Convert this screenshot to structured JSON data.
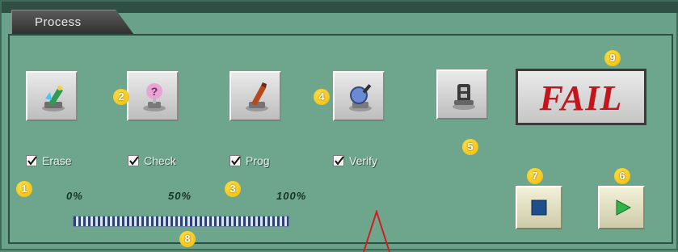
{
  "window": {
    "tab_title": "Process"
  },
  "buttons": {
    "erase": {
      "icon": "erase-pen-icon"
    },
    "check": {
      "icon": "check-question-icon"
    },
    "prog": {
      "icon": "program-pen-icon"
    },
    "verify": {
      "icon": "verify-magnifier-icon"
    },
    "device": {
      "icon": "device-chip-icon"
    }
  },
  "checkboxes": [
    {
      "label": "Erase",
      "checked": true
    },
    {
      "label": "Check",
      "checked": true
    },
    {
      "label": "Prog",
      "checked": true
    },
    {
      "label": "Verify",
      "checked": true
    }
  ],
  "progress": {
    "label_start": "0%",
    "label_mid": "50%",
    "label_end": "100%",
    "value": 1.0
  },
  "status": {
    "text": "FAIL",
    "color": "#c4151c"
  },
  "controls": {
    "stop_icon": "stop-icon",
    "start_icon": "play-icon"
  },
  "markers": [
    "1",
    "2",
    "3",
    "4",
    "5",
    "6",
    "7",
    "8",
    "9"
  ]
}
